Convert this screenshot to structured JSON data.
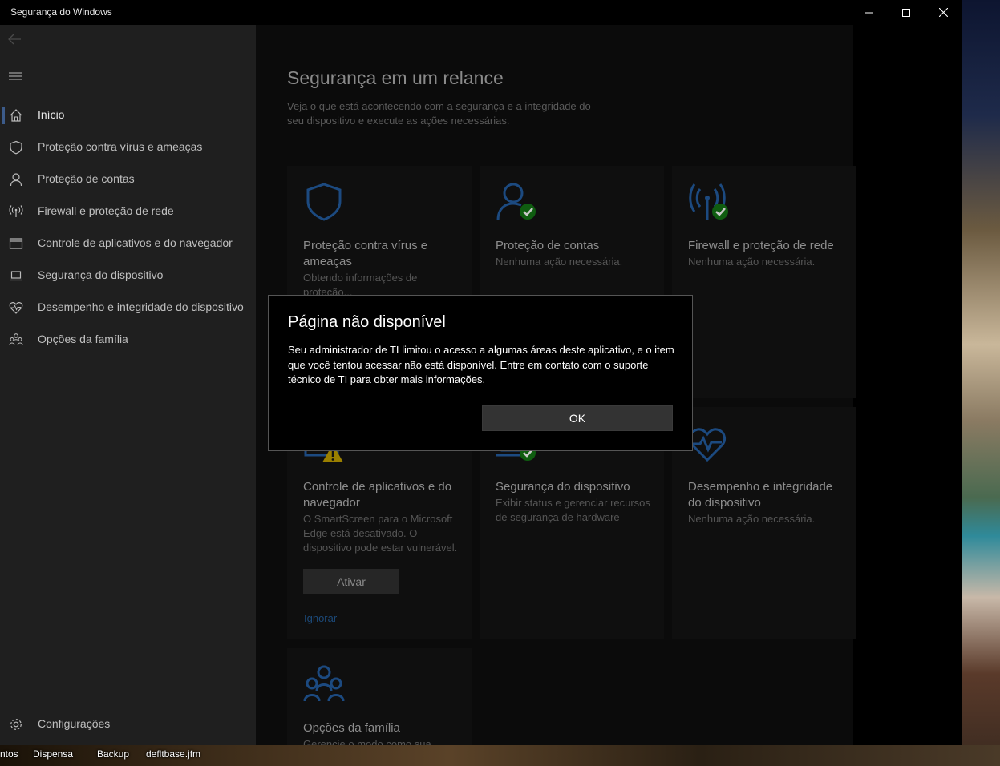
{
  "window": {
    "title": "Segurança do Windows"
  },
  "sidebar": {
    "items": [
      {
        "label": "Início",
        "icon": "home-icon"
      },
      {
        "label": "Proteção contra vírus e ameaças",
        "icon": "shield-icon"
      },
      {
        "label": "Proteção de contas",
        "icon": "person-icon"
      },
      {
        "label": "Firewall e proteção de rede",
        "icon": "antenna-icon"
      },
      {
        "label": "Controle de aplicativos e do navegador",
        "icon": "app-window-icon"
      },
      {
        "label": "Segurança do dispositivo",
        "icon": "laptop-icon"
      },
      {
        "label": "Desempenho e integridade do dispositivo",
        "icon": "heart-pulse-icon"
      },
      {
        "label": "Opções da família",
        "icon": "family-icon"
      }
    ],
    "settings_label": "Configurações"
  },
  "main": {
    "title": "Segurança em um relance",
    "subtitle": "Veja o que está acontecendo com a segurança e a integridade do seu dispositivo e execute as ações necessárias.",
    "cards": [
      {
        "title": "Proteção contra vírus e ameaças",
        "desc": "Obtendo informações de proteção..."
      },
      {
        "title": "Proteção de contas",
        "desc": "Nenhuma ação necessária."
      },
      {
        "title": "Firewall e proteção de rede",
        "desc": "Nenhuma ação necessária."
      },
      {
        "title": "Controle de aplicativos e do navegador",
        "desc": "O SmartScreen para o Microsoft Edge está desativado. O dispositivo pode estar vulnerável.",
        "button": "Ativar",
        "link": "Ignorar"
      },
      {
        "title": "Segurança do dispositivo",
        "desc": "Exibir status e gerenciar recursos de segurança de hardware"
      },
      {
        "title": "Desempenho e integridade do dispositivo",
        "desc": "Nenhuma ação necessária."
      },
      {
        "title": "Opções da família",
        "desc": "Gerencie o modo como sua"
      }
    ]
  },
  "dialog": {
    "title": "Página não disponível",
    "body": "Seu administrador de TI limitou o acesso a algumas áreas deste aplicativo, e o item que você tentou acessar não está disponível. Entre em contato com o suporte técnico de TI para obter mais informações.",
    "ok_label": "OK"
  },
  "desktop": {
    "icons": [
      "ntos",
      "Dispensa",
      "Backup",
      "defltbase.jfm"
    ]
  },
  "colors": {
    "accent": "#3c5b8a",
    "check_green": "#107c10",
    "warning_yellow": "#c8a400"
  }
}
